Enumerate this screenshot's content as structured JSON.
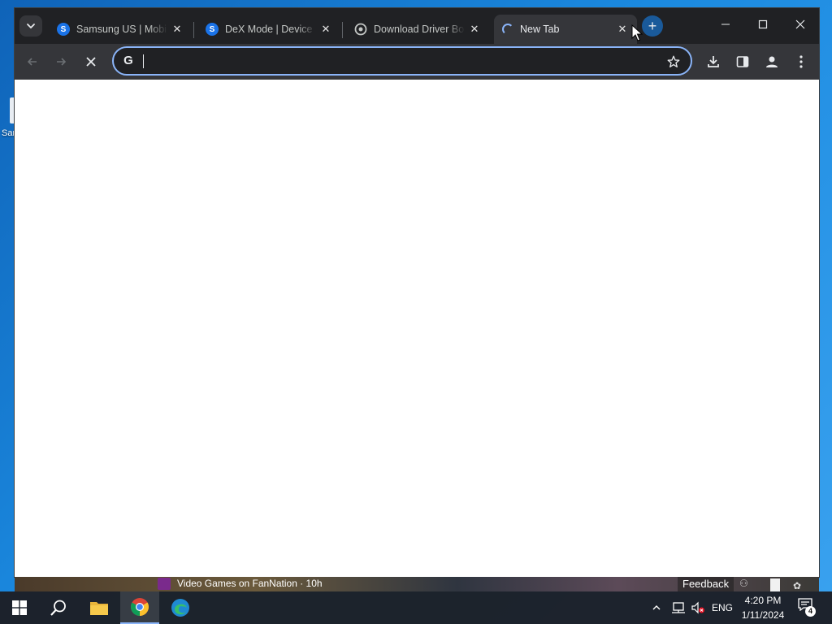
{
  "desktop": {
    "icon_label": "Samsung"
  },
  "browser": {
    "tabs": [
      {
        "title": "Samsung US | Mobile",
        "favicon": "samsung-icon",
        "favicon_letter": "S",
        "favicon_color": "#1a73e8",
        "active": false
      },
      {
        "title": "DeX Mode | Device Mode",
        "favicon": "samsung-icon",
        "favicon_letter": "S",
        "favicon_color": "#1a73e8",
        "active": false
      },
      {
        "title": "Download Driver Booster",
        "favicon": "driver-booster-icon",
        "active": false
      },
      {
        "title": "New Tab",
        "favicon": "loading-spinner",
        "active": true
      }
    ],
    "new_tab_label": "+",
    "omnibox": {
      "value": "",
      "placeholder": ""
    }
  },
  "newsbar": {
    "headline": "Video Games on FanNation · 10h",
    "feedback_label": "Feedback"
  },
  "taskbar": {
    "apps": [
      "start-icon",
      "search-icon",
      "file-explorer-icon",
      "chrome-icon",
      "edge-icon"
    ],
    "active_app": "chrome-icon",
    "language": "ENG",
    "time": "4:20 PM",
    "date": "1/11/2024",
    "notification_count": "4"
  },
  "colors": {
    "desktop": "#1a7fd6",
    "tabstrip": "#202124",
    "toolbar": "#35363a",
    "accent": "#8ab4f8",
    "taskbar": "#1c1e24"
  }
}
